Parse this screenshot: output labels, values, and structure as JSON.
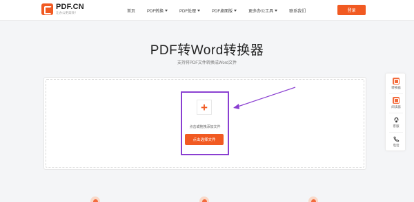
{
  "header": {
    "logo_name": "PDF.CN",
    "logo_slogan": "让办公更高效！",
    "nav": [
      {
        "label": "首页",
        "has_caret": false
      },
      {
        "label": "PDF转换",
        "has_caret": true
      },
      {
        "label": "PDF处理",
        "has_caret": true
      },
      {
        "label": "PDF桌面版",
        "has_caret": true
      },
      {
        "label": "更多办公工具",
        "has_caret": true
      },
      {
        "label": "联系我们",
        "has_caret": false
      }
    ],
    "login_label": "登录"
  },
  "hero": {
    "title": "PDF转Word转换器",
    "subtitle": "支持将PDF文件转换成Word文件"
  },
  "upload": {
    "plus_glyph": "+",
    "drop_hint": "点击或拖拽添加文件",
    "select_button": "点击选择文件"
  },
  "sidebar": {
    "items": [
      {
        "label": "转换器",
        "icon": "converter-icon"
      },
      {
        "label": "阅读器",
        "icon": "reader-icon"
      },
      {
        "label": "客服",
        "icon": "customer-service-icon"
      },
      {
        "label": "电话",
        "icon": "phone-icon"
      }
    ]
  },
  "colors": {
    "brand": "#f15a22",
    "highlight": "#8a3fd1"
  }
}
